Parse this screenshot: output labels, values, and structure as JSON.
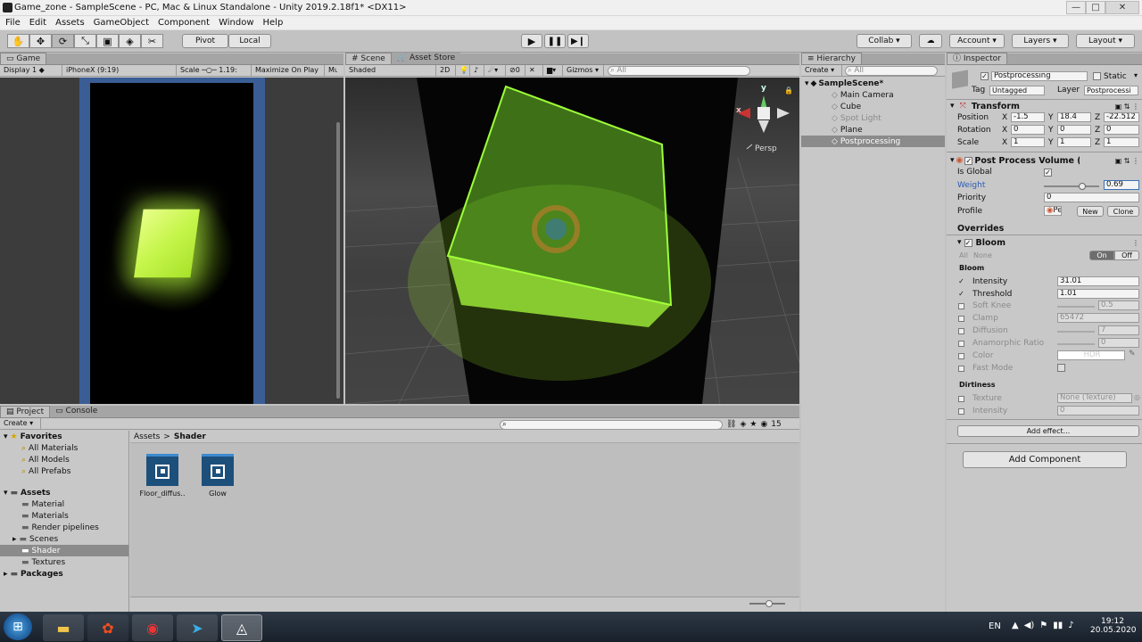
{
  "window": {
    "title": "Game_zone - SampleScene - PC, Mac & Linux Standalone - Unity 2019.2.18f1* <DX11>",
    "minimize": "—",
    "maximize": "□",
    "close": "✕"
  },
  "menu": [
    "File",
    "Edit",
    "Assets",
    "GameObject",
    "Component",
    "Window",
    "Help"
  ],
  "toolbar": {
    "pivot": "Pivot",
    "local": "Local",
    "collab": "Collab ▾",
    "account": "Account ▾",
    "layers": "Layers ▾",
    "layout": "Layout ▾"
  },
  "game": {
    "tab": "Game",
    "display": "Display 1",
    "resolution": "iPhoneX (9:19)",
    "scale_label": "Scale",
    "scale_value": "1.19:",
    "maximize": "Maximize On Play",
    "mute": "Mu"
  },
  "scene": {
    "tab": "Scene",
    "asset_store_tab": "Asset Store",
    "shading": "Shaded",
    "mode2d": "2D",
    "fx_count": "0",
    "gizmos": "Gizmos ▾",
    "search": "All",
    "persp": "Persp",
    "axis_x": "x",
    "axis_y": "y"
  },
  "hierarchy": {
    "tab": "Hierarchy",
    "create": "Create ▾",
    "search": "All",
    "scene": "SampleScene*",
    "items": [
      "Main Camera",
      "Cube",
      "Spot Light",
      "Plane",
      "Postprocessing"
    ]
  },
  "project": {
    "tab": "Project",
    "console_tab": "Console",
    "create": "Create ▾",
    "count": "15",
    "breadcrumb_root": "Assets",
    "breadcrumb_sep": ">",
    "breadcrumb_current": "Shader",
    "favorites": {
      "label": "Favorites",
      "items": [
        "All Materials",
        "All Models",
        "All Prefabs"
      ]
    },
    "assets": {
      "label": "Assets",
      "items": [
        "Material",
        "Materials",
        "Render pipelines",
        "Scenes",
        "Shader",
        "Textures"
      ]
    },
    "packages": "Packages",
    "files": [
      "Floor_diffus..",
      "Glow"
    ]
  },
  "inspector": {
    "tab": "Inspector",
    "object_name": "Postprocessing",
    "static_label": "Static",
    "tag_label": "Tag",
    "tag_value": "Untagged",
    "layer_label": "Layer",
    "layer_value": "Postprocessi",
    "transform": {
      "title": "Transform",
      "position_label": "Position",
      "position": {
        "x": "-1.5",
        "y": "18.4",
        "z": "-22.512"
      },
      "rotation_label": "Rotation",
      "rotation": {
        "x": "0",
        "y": "0",
        "z": "0"
      },
      "scale_label": "Scale",
      "scale": {
        "x": "1",
        "y": "1",
        "z": "1"
      }
    },
    "ppv": {
      "title": "Post Process Volume (S",
      "is_global": "Is Global",
      "weight_label": "Weight",
      "weight": "0.69",
      "weight_level": 0.69,
      "priority_label": "Priority",
      "priority": "0",
      "profile_label": "Profile",
      "profile_value": "Pe",
      "new": "New",
      "clone": "Clone"
    },
    "overrides": "Overrides",
    "bloom": {
      "title": "Bloom",
      "all": "All",
      "none": "None",
      "on": "On",
      "off": "Off",
      "section": "Bloom",
      "intensity_label": "Intensity",
      "intensity": "31.01",
      "threshold_label": "Threshold",
      "threshold": "1.01",
      "soft_knee_label": "Soft Knee",
      "soft_knee": "0.5",
      "clamp_label": "Clamp",
      "clamp": "65472",
      "diffusion_label": "Diffusion",
      "diffusion": "7",
      "anamorphic_label": "Anamorphic Ratio",
      "anamorphic": "0",
      "color_label": "Color",
      "color_value": "HDR",
      "fast_mode_label": "Fast Mode",
      "dirtiness": "Dirtiness",
      "texture_label": "Texture",
      "texture_value": "None (Texture)",
      "dirt_intensity_label": "Intensity",
      "dirt_intensity": "0"
    },
    "add_effect": "Add effect...",
    "add_component": "Add Component"
  },
  "taskbar": {
    "lang": "EN",
    "time": "19:12",
    "date": "20.05.2020"
  },
  "colors": {
    "accent_blue": "#3d6fb6",
    "glow_green": "#9eff3a",
    "selection": "#8b8b8b"
  }
}
